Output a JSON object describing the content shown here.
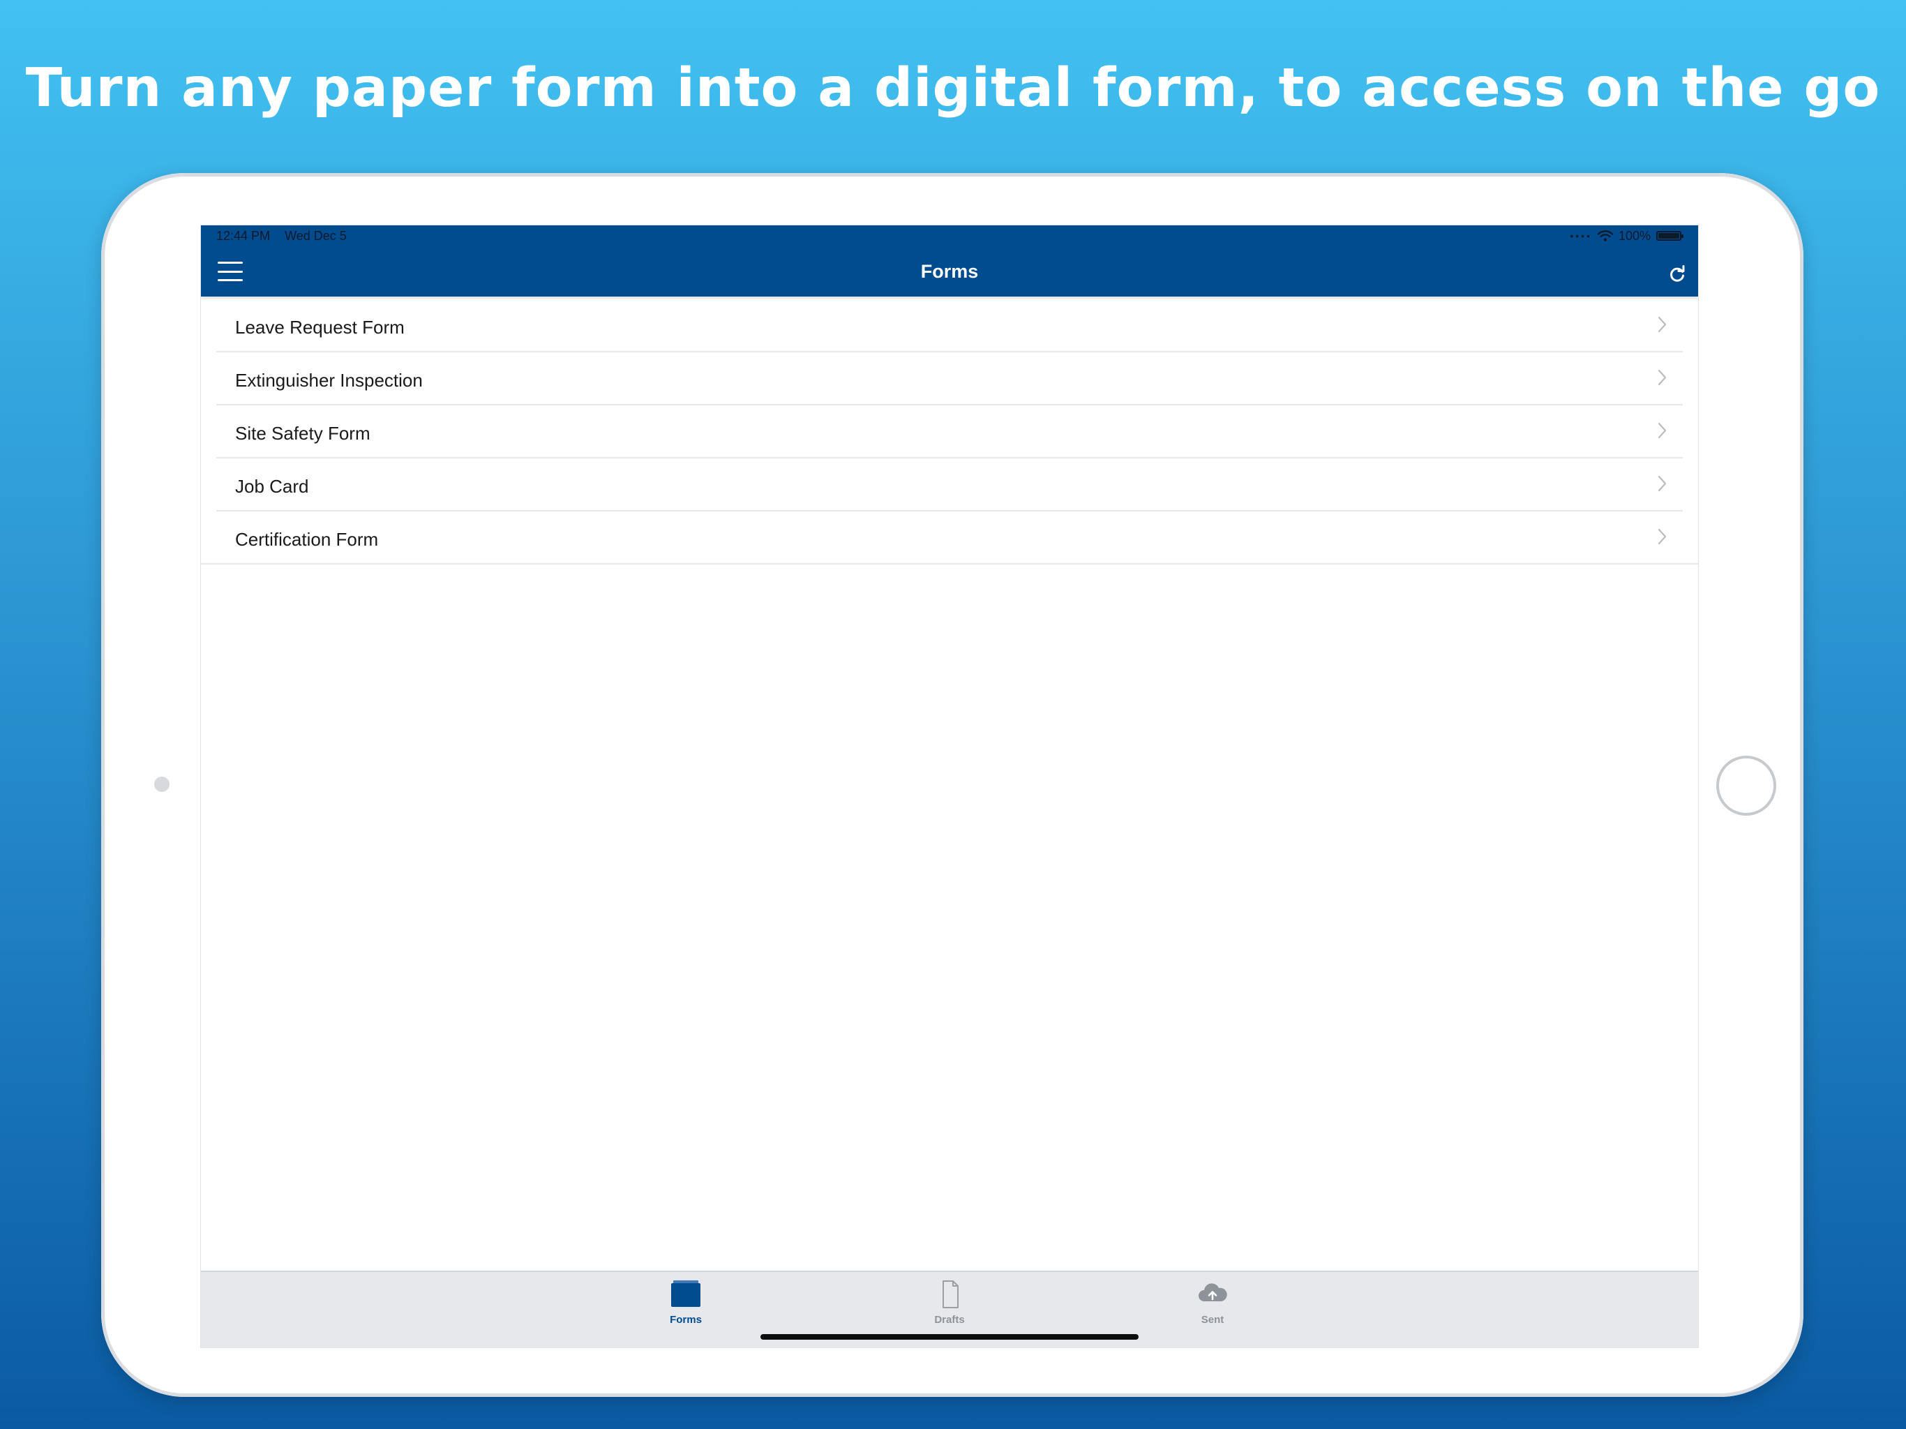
{
  "headline": "Turn any paper form into a digital form, to access on the go",
  "status_bar": {
    "time": "12:44 PM",
    "date": "Wed Dec 5",
    "battery": "100%"
  },
  "nav": {
    "title": "Forms",
    "menu_icon": "hamburger-menu-icon",
    "refresh_icon": "refresh-icon"
  },
  "forms": [
    {
      "label": "Leave Request Form"
    },
    {
      "label": "Extinguisher Inspection"
    },
    {
      "label": "Site Safety Form"
    },
    {
      "label": "Job Card"
    },
    {
      "label": "Certification Form"
    }
  ],
  "tabs": [
    {
      "label": "Forms",
      "icon": "folder-icon",
      "active": true
    },
    {
      "label": "Drafts",
      "icon": "document-icon",
      "active": false
    },
    {
      "label": "Sent",
      "icon": "cloud-upload-icon",
      "active": false
    }
  ],
  "colors": {
    "nav_background": "#014b8f",
    "active_tab": "#014b8f",
    "inactive_tab": "#8e9399",
    "tab_bar_background": "#e6e8eb"
  }
}
